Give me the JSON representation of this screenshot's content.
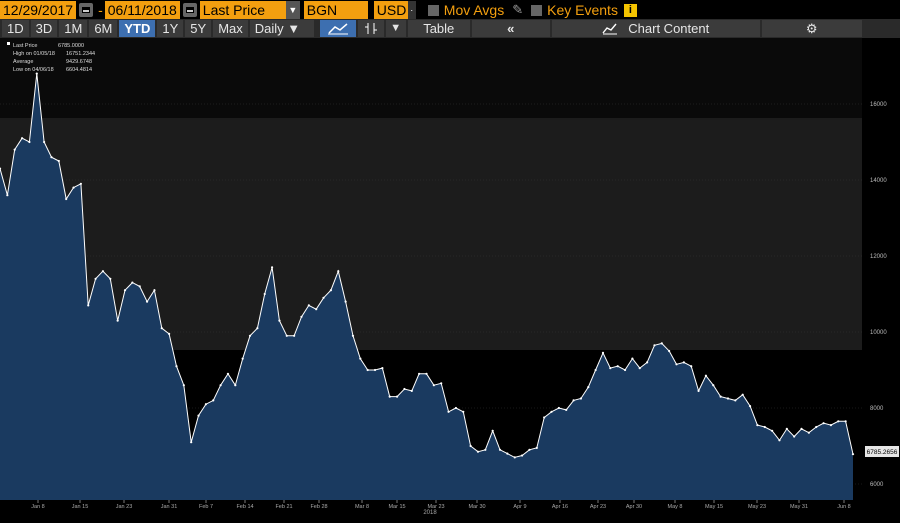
{
  "toolbar": {
    "start_date": "12/29/2017",
    "end_date": "06/11/2018",
    "dash": "-",
    "field": "Last Price",
    "currency_label": "BGN",
    "currency": "USD",
    "mov_avgs": "Mov Avgs",
    "key_events": "Key Events",
    "info": "i"
  },
  "periods": [
    "1D",
    "3D",
    "1M",
    "6M",
    "YTD",
    "1Y",
    "5Y",
    "Max"
  ],
  "active_period": "YTD",
  "frequency": "Daily",
  "table_label": "Table",
  "chart_content_label": "Chart Content",
  "legend": {
    "last_price_label": "Last Price",
    "last_price_value": "6785.0000",
    "high_label": "High on 01/05/18",
    "high_value": "16751.2344",
    "average_label": "Average",
    "average_value": "9429.6748",
    "low_label": "Low on 04/06/18",
    "low_value": "6604.4814"
  },
  "colors": {
    "accent": "#f39f0f",
    "line": "#ffffff",
    "area": "#1a3a60",
    "active": "#3d6fb0"
  },
  "chart_data": {
    "type": "area",
    "x_tick_labels": [
      "Jan 8",
      "Jan 15",
      "Jan 23",
      "Jan 31",
      "Feb 7",
      "Feb 14",
      "Feb 21",
      "Feb 28",
      "Mar 8",
      "Mar 15",
      "Mar 23",
      "Mar 30",
      "Apr 9",
      "Apr 16",
      "Apr 23",
      "Apr 30",
      "May 8",
      "May 15",
      "May 23",
      "May 31",
      "Jun 8"
    ],
    "x_year_label": "2018",
    "y_tick_labels": [
      "6000",
      "8000",
      "10000",
      "12000",
      "14000",
      "16000"
    ],
    "ylim": [
      5700,
      17200
    ],
    "last_value_label": "6785.2656",
    "values": [
      14300,
      13600,
      14800,
      15100,
      15000,
      16800,
      15000,
      14600,
      14500,
      13500,
      13800,
      13900,
      10700,
      11400,
      11600,
      11400,
      10300,
      11100,
      11300,
      11200,
      10800,
      11100,
      10100,
      9950,
      9100,
      8600,
      7100,
      7800,
      8100,
      8200,
      8600,
      8900,
      8600,
      9300,
      9900,
      10100,
      11000,
      11700,
      10300,
      9900,
      9900,
      10400,
      10700,
      10600,
      10900,
      11100,
      11600,
      10800,
      9900,
      9300,
      9000,
      9000,
      9050,
      8300,
      8300,
      8500,
      8450,
      8900,
      8900,
      8600,
      8650,
      7900,
      8000,
      7900,
      7000,
      6850,
      6900,
      7400,
      6900,
      6800,
      6700,
      6750,
      6900,
      6950,
      7750,
      7900,
      8000,
      7950,
      8200,
      8250,
      8550,
      9000,
      9450,
      9050,
      9100,
      9000,
      9300,
      9050,
      9200,
      9650,
      9700,
      9500,
      9150,
      9200,
      9100,
      8450,
      8850,
      8600,
      8300,
      8250,
      8200,
      8350,
      8050,
      7550,
      7500,
      7400,
      7150,
      7450,
      7250,
      7450,
      7350,
      7500,
      7600,
      7550,
      7650,
      7650,
      6785
    ]
  }
}
